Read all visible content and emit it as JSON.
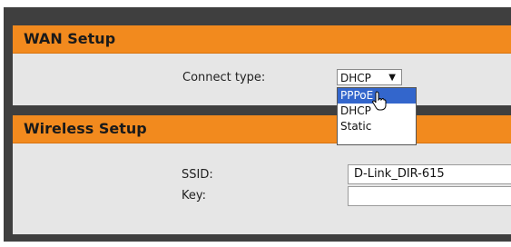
{
  "wan": {
    "title": "WAN Setup",
    "connect_type_label": "Connect type:",
    "connect_type_value": "DHCP",
    "options": [
      "PPPoE",
      "DHCP",
      "Static"
    ],
    "highlighted_option": "PPPoE"
  },
  "wireless": {
    "title": "Wireless Setup",
    "ssid_label": "SSID:",
    "ssid_value": "D-Link_DIR-615",
    "key_label": "Key:",
    "key_value": ""
  },
  "colors": {
    "header": "#f28a1e",
    "panel_bg": "#e6e6e6",
    "frame": "#3f3f3f",
    "selection": "#3366cc"
  },
  "icons": {
    "dropdown_arrow": "triangle-down-icon",
    "cursor": "hand-pointer-icon"
  }
}
